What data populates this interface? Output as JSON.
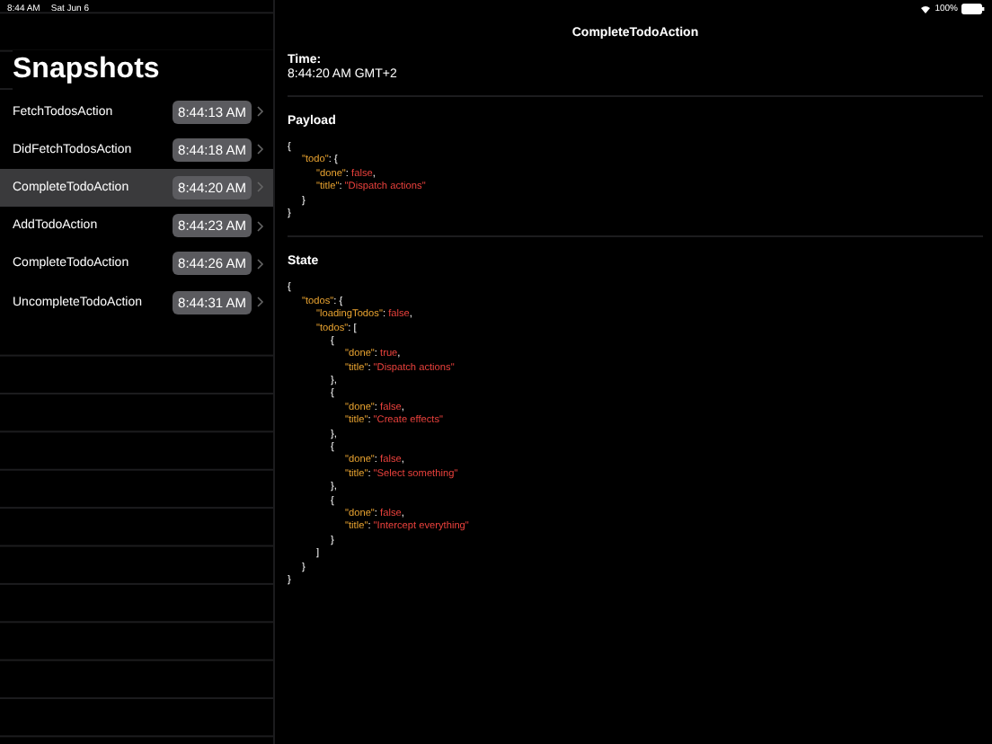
{
  "status_bar": {
    "time": "8:44 AM",
    "date": "Sat Jun 6",
    "battery": "100%"
  },
  "sidebar": {
    "title": "Snapshots",
    "items": [
      {
        "label": "FetchTodosAction",
        "time": "8:44:13 AM",
        "selected": false
      },
      {
        "label": "DidFetchTodosAction",
        "time": "8:44:18 AM",
        "selected": false
      },
      {
        "label": "CompleteTodoAction",
        "time": "8:44:20 AM",
        "selected": true
      },
      {
        "label": "AddTodoAction",
        "time": "8:44:23 AM",
        "selected": false
      },
      {
        "label": "CompleteTodoAction",
        "time": "8:44:26 AM",
        "selected": false
      },
      {
        "label": "UncompleteTodoAction",
        "time": "8:44:31 AM",
        "selected": false
      }
    ]
  },
  "detail": {
    "title": "CompleteTodoAction",
    "time_label": "Time:",
    "time_value": "8:44:20 AM GMT+2",
    "sections": [
      {
        "heading": "Payload",
        "code": [
          {
            "tokens": [
              {
                "kind": "punct",
                "text": "{"
              }
            ],
            "children": [
              {
                "tokens": [
                  {
                    "kind": "key",
                    "text": "\"todo\""
                  },
                  {
                    "kind": "punct",
                    "text": ": {"
                  }
                ],
                "children": [
                  {
                    "tokens": [
                      {
                        "kind": "key",
                        "text": "\"done\""
                      },
                      {
                        "kind": "punct",
                        "text": ": "
                      },
                      {
                        "kind": "value",
                        "text": "false"
                      },
                      {
                        "kind": "punct",
                        "text": ","
                      }
                    ]
                  },
                  {
                    "tokens": [
                      {
                        "kind": "key",
                        "text": "\"title\""
                      },
                      {
                        "kind": "punct",
                        "text": ": "
                      },
                      {
                        "kind": "value",
                        "text": "\"Dispatch actions\""
                      }
                    ]
                  }
                ]
              },
              {
                "tokens": [
                  {
                    "kind": "punct",
                    "text": "}"
                  }
                ]
              }
            ]
          },
          {
            "tokens": [
              {
                "kind": "punct",
                "text": "}"
              }
            ]
          }
        ]
      },
      {
        "heading": "State",
        "code": [
          {
            "tokens": [
              {
                "kind": "punct",
                "text": "{"
              }
            ],
            "children": [
              {
                "tokens": [
                  {
                    "kind": "key",
                    "text": "\"todos\""
                  },
                  {
                    "kind": "punct",
                    "text": ": {"
                  }
                ],
                "children": [
                  {
                    "tokens": [
                      {
                        "kind": "key",
                        "text": "\"loadingTodos\""
                      },
                      {
                        "kind": "punct",
                        "text": ": "
                      },
                      {
                        "kind": "value",
                        "text": "false"
                      },
                      {
                        "kind": "punct",
                        "text": ","
                      }
                    ]
                  },
                  {
                    "tokens": [
                      {
                        "kind": "key",
                        "text": "\"todos\""
                      },
                      {
                        "kind": "punct",
                        "text": ": ["
                      }
                    ],
                    "children": [
                      {
                        "tokens": [
                          {
                            "kind": "punct",
                            "text": "{"
                          }
                        ],
                        "children": [
                          {
                            "tokens": [
                              {
                                "kind": "key",
                                "text": "\"done\""
                              },
                              {
                                "kind": "punct",
                                "text": ": "
                              },
                              {
                                "kind": "value",
                                "text": "true"
                              },
                              {
                                "kind": "punct",
                                "text": ","
                              }
                            ]
                          },
                          {
                            "tokens": [
                              {
                                "kind": "key",
                                "text": "\"title\""
                              },
                              {
                                "kind": "punct",
                                "text": ": "
                              },
                              {
                                "kind": "value",
                                "text": "\"Dispatch actions\""
                              }
                            ]
                          }
                        ]
                      },
                      {
                        "tokens": [
                          {
                            "kind": "punct",
                            "text": "},"
                          }
                        ]
                      },
                      {
                        "tokens": [
                          {
                            "kind": "punct",
                            "text": "{"
                          }
                        ],
                        "children": [
                          {
                            "tokens": [
                              {
                                "kind": "key",
                                "text": "\"done\""
                              },
                              {
                                "kind": "punct",
                                "text": ": "
                              },
                              {
                                "kind": "value",
                                "text": "false"
                              },
                              {
                                "kind": "punct",
                                "text": ","
                              }
                            ]
                          },
                          {
                            "tokens": [
                              {
                                "kind": "key",
                                "text": "\"title\""
                              },
                              {
                                "kind": "punct",
                                "text": ": "
                              },
                              {
                                "kind": "value",
                                "text": "\"Create effects\""
                              }
                            ]
                          }
                        ]
                      },
                      {
                        "tokens": [
                          {
                            "kind": "punct",
                            "text": "},"
                          }
                        ]
                      },
                      {
                        "tokens": [
                          {
                            "kind": "punct",
                            "text": "{"
                          }
                        ],
                        "children": [
                          {
                            "tokens": [
                              {
                                "kind": "key",
                                "text": "\"done\""
                              },
                              {
                                "kind": "punct",
                                "text": ": "
                              },
                              {
                                "kind": "value",
                                "text": "false"
                              },
                              {
                                "kind": "punct",
                                "text": ","
                              }
                            ]
                          },
                          {
                            "tokens": [
                              {
                                "kind": "key",
                                "text": "\"title\""
                              },
                              {
                                "kind": "punct",
                                "text": ": "
                              },
                              {
                                "kind": "value",
                                "text": "\"Select something\""
                              }
                            ]
                          }
                        ]
                      },
                      {
                        "tokens": [
                          {
                            "kind": "punct",
                            "text": "},"
                          }
                        ]
                      },
                      {
                        "tokens": [
                          {
                            "kind": "punct",
                            "text": "{"
                          }
                        ],
                        "children": [
                          {
                            "tokens": [
                              {
                                "kind": "key",
                                "text": "\"done\""
                              },
                              {
                                "kind": "punct",
                                "text": ": "
                              },
                              {
                                "kind": "value",
                                "text": "false"
                              },
                              {
                                "kind": "punct",
                                "text": ","
                              }
                            ]
                          },
                          {
                            "tokens": [
                              {
                                "kind": "key",
                                "text": "\"title\""
                              },
                              {
                                "kind": "punct",
                                "text": ": "
                              },
                              {
                                "kind": "value",
                                "text": "\"Intercept everything\""
                              }
                            ]
                          }
                        ]
                      },
                      {
                        "tokens": [
                          {
                            "kind": "punct",
                            "text": "}"
                          }
                        ]
                      }
                    ]
                  },
                  {
                    "tokens": [
                      {
                        "kind": "punct",
                        "text": "]"
                      }
                    ]
                  }
                ]
              },
              {
                "tokens": [
                  {
                    "kind": "punct",
                    "text": "}"
                  }
                ]
              }
            ]
          },
          {
            "tokens": [
              {
                "kind": "punct",
                "text": "}"
              }
            ]
          }
        ]
      }
    ]
  }
}
